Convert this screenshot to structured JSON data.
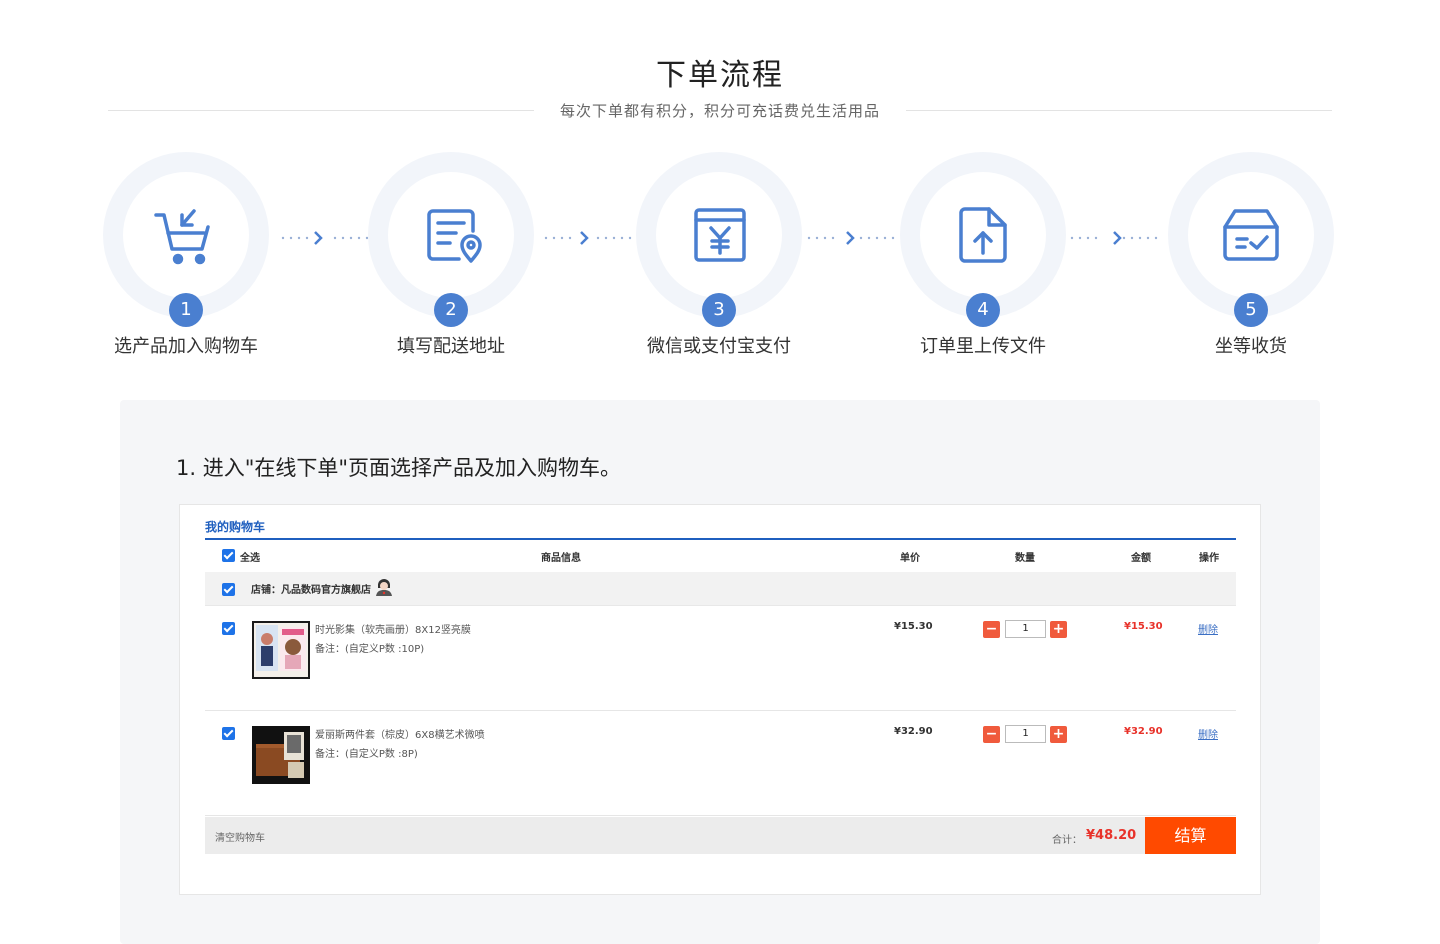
{
  "header": {
    "title": "下单流程",
    "subtitle": "每次下单都有积分，积分可充话费兑生活用品"
  },
  "steps": [
    {
      "num": "1",
      "label": "选产品加入购物车",
      "icon": "cart-icon"
    },
    {
      "num": "2",
      "label": "填写配送地址",
      "icon": "address-doc-icon"
    },
    {
      "num": "3",
      "label": "微信或支付宝支付",
      "icon": "yuan-payment-icon"
    },
    {
      "num": "4",
      "label": "订单里上传文件",
      "icon": "upload-file-icon"
    },
    {
      "num": "5",
      "label": "坐等收货",
      "icon": "receive-box-icon"
    }
  ],
  "instruction": {
    "heading": "1. 进入\"在线下单\"页面选择产品及加入购物车。"
  },
  "cart": {
    "title": "我的购物车",
    "columns": {
      "select_all": "全选",
      "product_info": "商品信息",
      "unit_price": "单价",
      "quantity": "数量",
      "amount": "金额",
      "action": "操作"
    },
    "store": {
      "label": "店铺：凡品数码官方旗舰店",
      "avatar_icon": "store-avatar-icon"
    },
    "items": [
      {
        "name": "时光影集（软壳画册）8X12竖亮膜",
        "note": "备注：(自定义P数 :10P)",
        "price": "¥15.30",
        "qty": "1",
        "total": "¥15.30",
        "delete_label": "删除",
        "checked": true
      },
      {
        "name": "爱丽斯两件套（棕皮）6X8横艺术微喷",
        "note": "备注：(自定义P数 :8P)",
        "price": "¥32.90",
        "qty": "1",
        "total": "¥32.90",
        "delete_label": "删除",
        "checked": true
      }
    ],
    "footer": {
      "clear_label": "清空购物车",
      "total_label": "合计：",
      "total_value": "¥48.20",
      "checkout_label": "结算"
    },
    "colors": {
      "accent": "#1f5fbf",
      "checkout": "#ff4a00",
      "price_red": "#e8322a",
      "step_blue": "#4a7fd0"
    }
  }
}
